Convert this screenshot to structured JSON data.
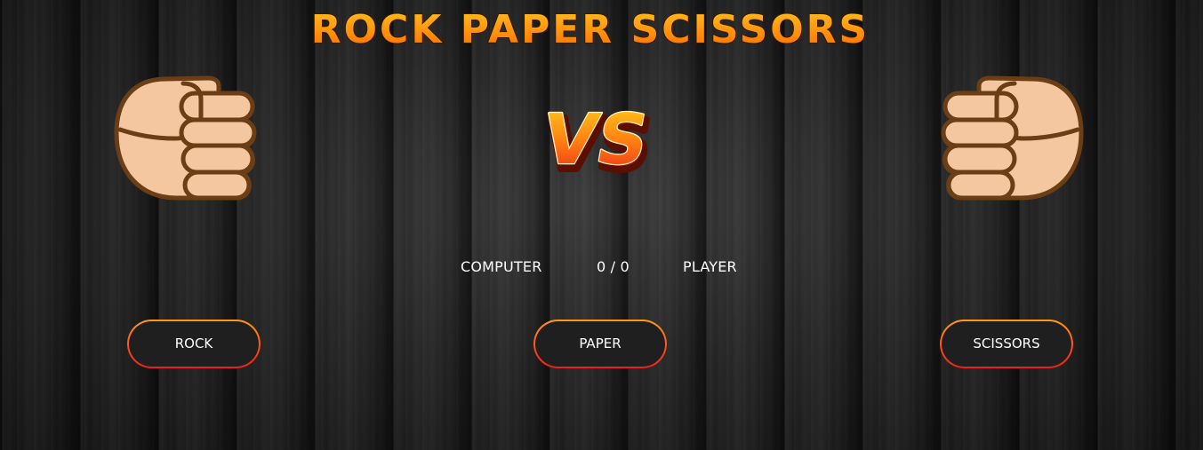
{
  "game": {
    "title": "ROCK PAPER SCISSORS",
    "vs_label": "VS"
  },
  "score": {
    "computer_label": "COMPUTER",
    "value": "0 / 0",
    "player_label": "PLAYER"
  },
  "choices": {
    "rock": "ROCK",
    "paper": "PAPER",
    "scissors": "SCISSORS"
  },
  "hands": {
    "computer": "fist-icon",
    "player": "fist-icon"
  },
  "colors": {
    "title_fill_top": "#ffb020",
    "title_fill_bottom": "#ff6a00",
    "button_border": "#ff6a1a",
    "skin": "#f4c7a0",
    "outline": "#6b3e16",
    "background": "#1b1b1b"
  }
}
